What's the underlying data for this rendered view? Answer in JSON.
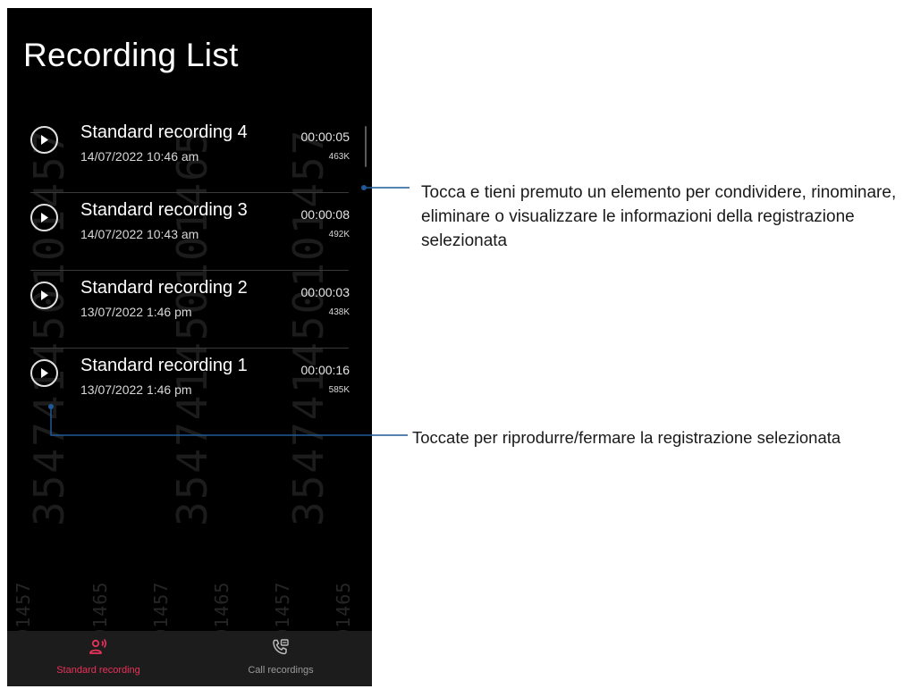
{
  "screen": {
    "title": "Recording List",
    "watermark_small": "450101457",
    "watermark_small_2": "450101465",
    "watermark_big": "354741450101457",
    "watermark_big_2": "354741450101465",
    "watermark_bottom": "354741450101457",
    "watermark_bottom_2": "354741450101465"
  },
  "recordings": [
    {
      "name": "Standard recording 4",
      "date": "14/07/2022 10:46 am",
      "duration": "00:00:05",
      "size": "463K"
    },
    {
      "name": "Standard recording 3",
      "date": "14/07/2022 10:43 am",
      "duration": "00:00:08",
      "size": "492K"
    },
    {
      "name": "Standard recording 2",
      "date": "13/07/2022 1:46 pm",
      "duration": "00:00:03",
      "size": "438K"
    },
    {
      "name": "Standard recording 1",
      "date": "13/07/2022 1:46 pm",
      "duration": "00:00:16",
      "size": "585K"
    }
  ],
  "bottom_nav": {
    "standard_label": "Standard recording",
    "call_label": "Call recordings",
    "active_color": "#e8325a"
  },
  "callouts": {
    "long_press": "Tocca e tieni premuto un elemento per condividere, rinominare, eliminare o visualizzare le informazioni della registrazione selezionata",
    "play": "Toccate per riprodurre/fermare la registrazione selezionata",
    "line_color": "#1f5a96"
  },
  "icons": {
    "play": "play-icon",
    "standard": "microphone-person-icon",
    "call": "phone-recording-icon"
  }
}
